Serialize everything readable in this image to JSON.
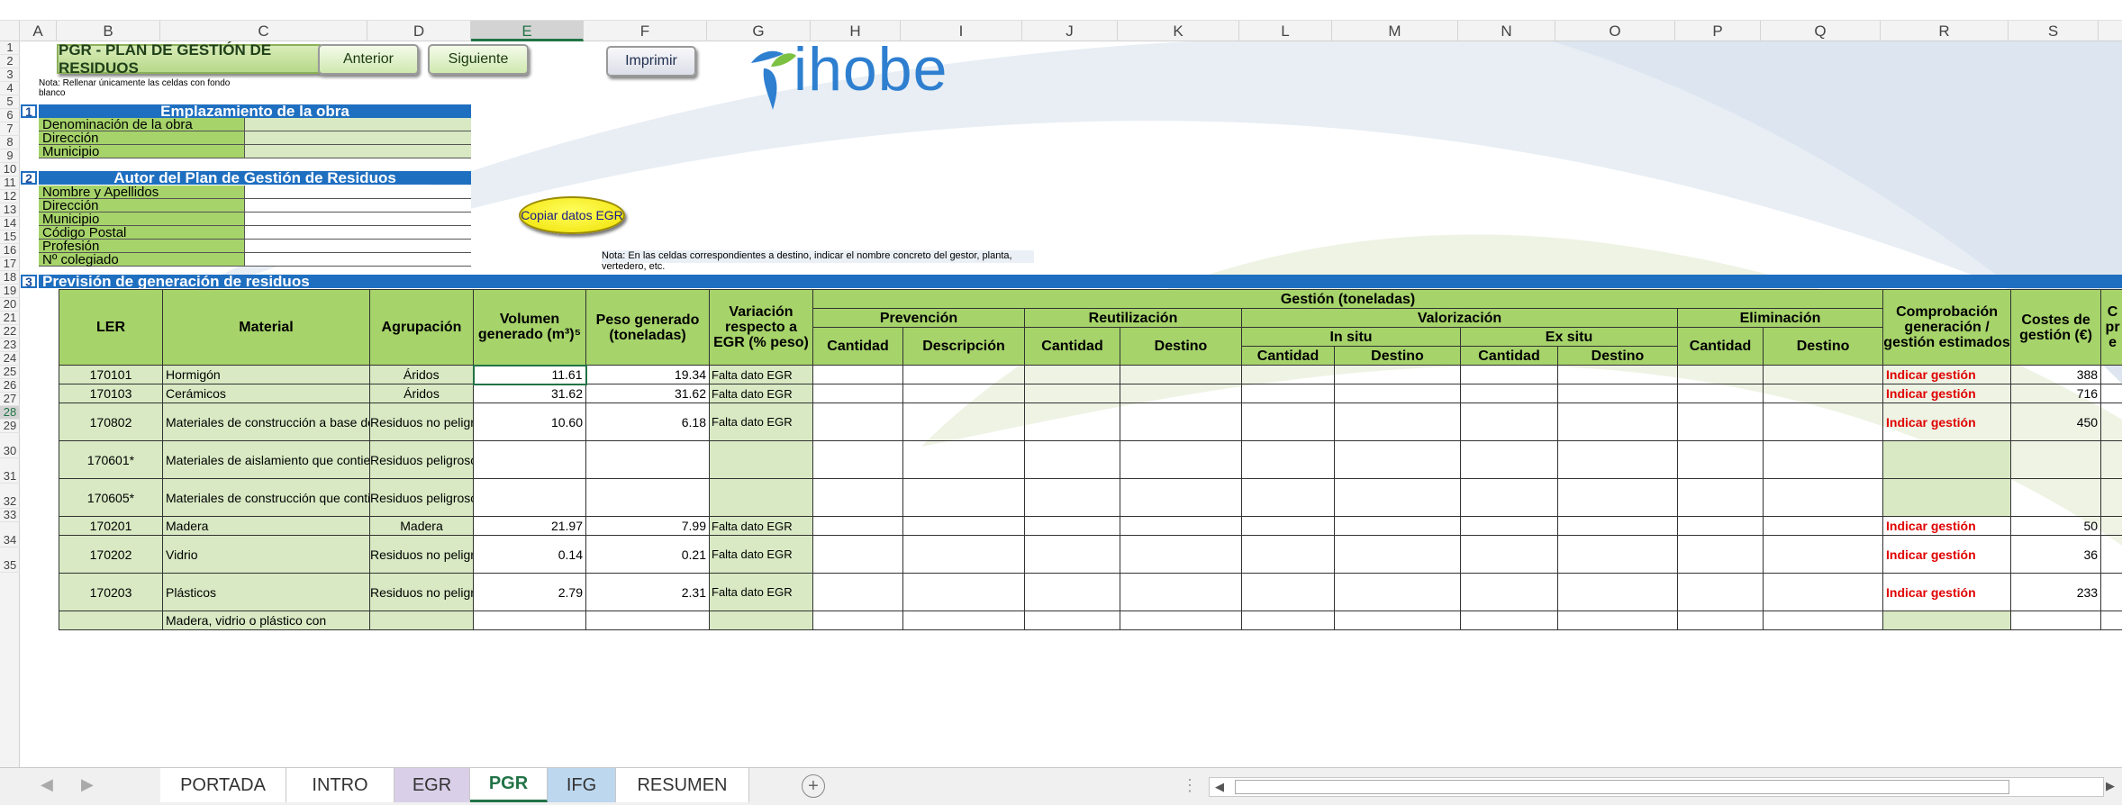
{
  "columns": [
    "A",
    "B",
    "C",
    "D",
    "E",
    "F",
    "G",
    "H",
    "I",
    "J",
    "K",
    "L",
    "M",
    "N",
    "O",
    "P",
    "Q",
    "R",
    "S"
  ],
  "selected_column": "E",
  "selected_row": "28",
  "rows": [
    "1",
    "2",
    "3",
    "4",
    "5",
    "6",
    "7",
    "8",
    "9",
    "10",
    "11",
    "12",
    "13",
    "14",
    "15",
    "16",
    "17",
    "18",
    "19",
    "20",
    "21",
    "22",
    "23",
    "24",
    "25",
    "26",
    "27",
    "28",
    "29",
    "30",
    "31",
    "32",
    "33",
    "34",
    "35"
  ],
  "header": {
    "title": "PGR - PLAN DE GESTIÓN DE RESIDUOS",
    "note": "Nota: Rellenar únicamente las celdas con fondo blanco",
    "btn_prev": "Anterior",
    "btn_next": "Siguiente",
    "btn_print": "Imprimir",
    "logo_text": "ihobe"
  },
  "section1": {
    "num": "1",
    "title": "Emplazamiento de la obra",
    "fields": [
      "Denominación de la obra",
      "Dirección",
      "Municipio"
    ]
  },
  "section2": {
    "num": "2",
    "title": "Autor del Plan de Gestión de Residuos",
    "fields": [
      "Nombre y Apellidos",
      "Dirección",
      "Municipio",
      "Código Postal",
      "Profesión",
      "Nº colegiado"
    ]
  },
  "copy_button": "Copiar datos EGR",
  "destino_note": "Nota: En las celdas correspondientes a destino, indicar el nombre concreto del gestor, planta, vertedero, etc.",
  "section3": {
    "num": "3",
    "title": "Previsión de generación de residuos",
    "headers": {
      "ler": "LER",
      "material": "Material",
      "agrupacion": "Agrupación",
      "volumen": "Volumen generado (m³)⁵",
      "peso": "Peso generado (toneladas)",
      "variacion": "Variación respecto a EGR (% peso)",
      "gestion": "Gestión (toneladas)",
      "prevencion": "Prevención",
      "reutilizacion": "Reutilización",
      "valorizacion": "Valorización",
      "insitu": "In situ",
      "exsitu": "Ex situ",
      "eliminacion": "Eliminación",
      "cantidad": "Cantidad",
      "descripcion": "Descripción",
      "destino": "Destino",
      "comprobacion": "Comprobación generación / gestión estimados",
      "costes": "Costes de gestión (€)",
      "col_t_partial": "C pr e"
    },
    "rows": [
      {
        "ler": "170101",
        "material": "Hormigón",
        "agrup": "Áridos",
        "vol": "11.61",
        "peso": "19.34",
        "var": "Falta dato EGR",
        "comp": "Indicar gestión",
        "cost": "388"
      },
      {
        "ler": "170103",
        "material": "Cerámicos",
        "agrup": "Áridos",
        "vol": "31.62",
        "peso": "31.62",
        "var": "Falta dato EGR",
        "comp": "Indicar gestión",
        "cost": "716"
      },
      {
        "ler": "170802",
        "material": "Materiales de construcción a base de yeso",
        "agrup": "Residuos no peligrosos",
        "vol": "10.60",
        "peso": "6.18",
        "var": "Falta dato EGR",
        "comp": "Indicar gestión",
        "cost": "450"
      },
      {
        "ler": "170601*",
        "material": "Materiales de aislamiento que contienen amianto",
        "agrup": "Residuos peligrosos",
        "vol": "",
        "peso": "",
        "var": "",
        "comp": "",
        "cost": ""
      },
      {
        "ler": "170605*",
        "material": "Materiales de construcción que contienen amianto",
        "agrup": "Residuos peligrosos",
        "vol": "",
        "peso": "",
        "var": "",
        "comp": "",
        "cost": ""
      },
      {
        "ler": "170201",
        "material": "Madera",
        "agrup": "Madera",
        "vol": "21.97",
        "peso": "7.99",
        "var": "Falta dato EGR",
        "comp": "Indicar gestión",
        "cost": "50"
      },
      {
        "ler": "170202",
        "material": "Vidrio",
        "agrup": "Residuos no peligrosos",
        "vol": "0.14",
        "peso": "0.21",
        "var": "Falta dato EGR",
        "comp": "Indicar gestión",
        "cost": "36"
      },
      {
        "ler": "170203",
        "material": "Plásticos",
        "agrup": "Residuos no peligrosos",
        "vol": "2.79",
        "peso": "2.31",
        "var": "Falta dato EGR",
        "comp": "Indicar gestión",
        "cost": "233"
      },
      {
        "ler": "",
        "material": "Madera, vidrio o plástico con",
        "agrup": "",
        "vol": "",
        "peso": "",
        "var": "",
        "comp": "",
        "cost": ""
      }
    ]
  },
  "sheet_tabs": [
    "PORTADA",
    "INTRO",
    "EGR",
    "PGR",
    "IFG",
    "RESUMEN"
  ],
  "active_tab": "PGR",
  "colors": {
    "green_header": "#a6d36a",
    "light_green": "#d8e9c3",
    "blue_band": "#1f6fc0",
    "logo_blue": "#2e7fd0",
    "logo_green": "#7cc142",
    "alert_red": "#e00000"
  }
}
